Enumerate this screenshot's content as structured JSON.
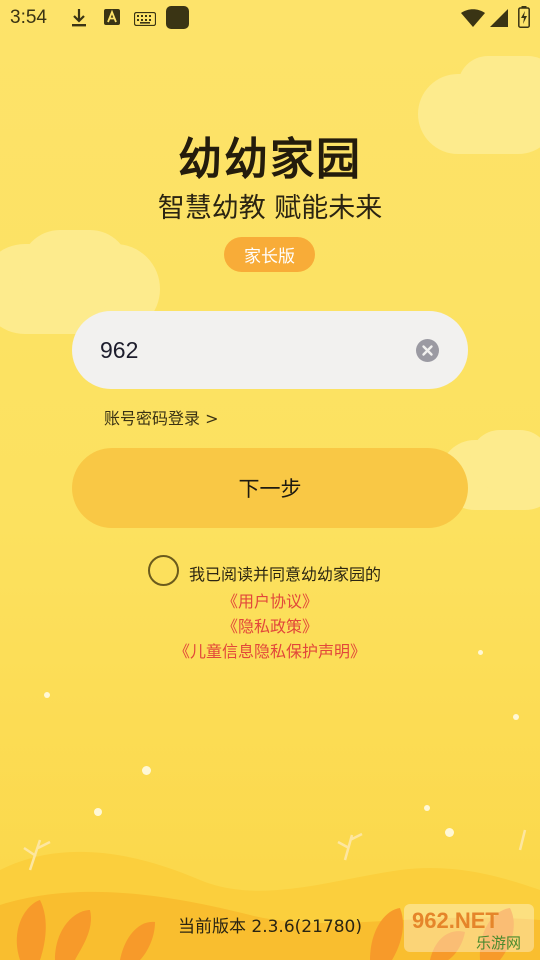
{
  "status_bar": {
    "time": "3:54",
    "left_icons": [
      "download-icon",
      "font-a-icon",
      "keyboard-icon",
      "app-square-icon"
    ],
    "right_icons": [
      "wifi-icon",
      "signal-icon",
      "battery-icon"
    ]
  },
  "header": {
    "title": "幼幼家园",
    "subtitle": "智慧幼教 赋能未来",
    "badge": "家长版"
  },
  "login": {
    "phone_value": "962",
    "password_login_link": "账号密码登录 >",
    "next_button": "下一步"
  },
  "agreement": {
    "text": "我已阅读并同意幼幼家园的",
    "user_agreement": "《用户协议》",
    "privacy_policy": "《隐私政策》",
    "child_privacy": "《儿童信息隐私保护声明》",
    "checked": false
  },
  "footer": {
    "version": "当前版本 2.3.6(21780)"
  },
  "watermark": {
    "top": "962.NET",
    "bottom": "乐游网"
  },
  "colors": {
    "background": "#fde36a",
    "badge": "#f8ac38",
    "button": "#f9c845",
    "link": "#e2473a",
    "input": "#f2f1ef"
  }
}
